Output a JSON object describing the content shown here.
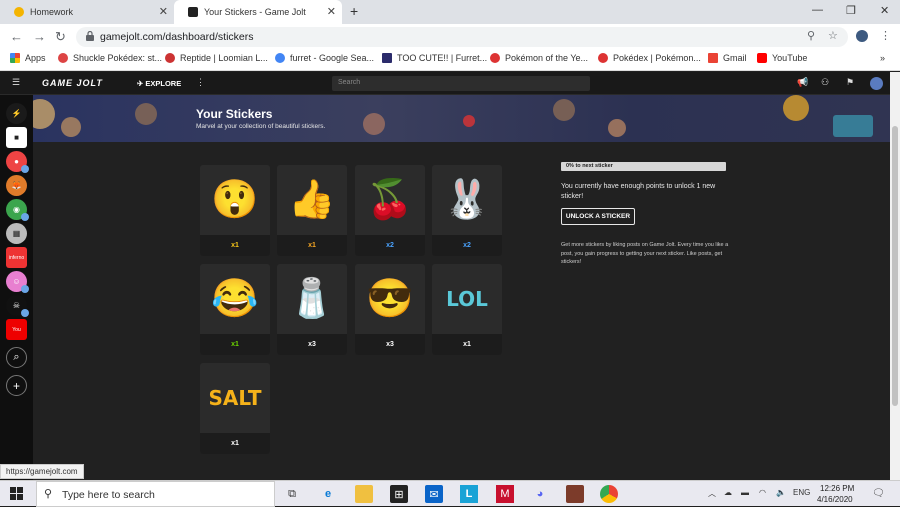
{
  "browser": {
    "tabs": [
      {
        "title": "Homework",
        "icon": "google-classroom-icon"
      },
      {
        "title": "Your Stickers - Game Jolt",
        "icon": "gamejolt-icon"
      }
    ],
    "url": "gamejolt.com/dashboard/stickers",
    "bookmarks": [
      {
        "label": "Apps",
        "color": "#e44"
      },
      {
        "label": "Shuckle Pokédex: st...",
        "color": "#d44"
      },
      {
        "label": "Reptide | Loomian L...",
        "color": "#c33"
      },
      {
        "label": "furret - Google Sea...",
        "color": "#4285f4"
      },
      {
        "label": "TOO CUTE!! | Furret...",
        "color": "#2b2b6b"
      },
      {
        "label": "Pokémon of the Ye...",
        "color": "#d33"
      },
      {
        "label": "Pokédex | Pokémon...",
        "color": "#d33"
      },
      {
        "label": "Gmail",
        "color": "#ea4335"
      },
      {
        "label": "YouTube",
        "color": "#f00"
      }
    ],
    "status_url": "https://gamejolt.com"
  },
  "gamejolt": {
    "logo": "GAME JOLT",
    "explore": "EXPLORE",
    "search_placeholder": "Search",
    "banner_title": "Your Stickers",
    "banner_subtitle": "Marvel at your collection of beautiful stickers."
  },
  "stickers": [
    {
      "emoji": "😲",
      "count": "x1",
      "count_color": "#f5c518",
      "name": "surprised-egg-sticker"
    },
    {
      "emoji": "👍",
      "count": "x1",
      "count_color": "#f5a623",
      "name": "painter-thumbs-up-sticker"
    },
    {
      "emoji": "🍒",
      "count": "x2",
      "count_color": "#4aa3ff",
      "name": "cherries-sticker"
    },
    {
      "emoji": "🐰",
      "count": "x2",
      "count_color": "#4aa3ff",
      "name": "confused-bunny-sticker"
    },
    {
      "emoji": "😂",
      "count": "x1",
      "count_color": "#6cd400",
      "name": "laughing-sticker"
    },
    {
      "emoji": "🧂",
      "count": "x3",
      "count_color": "#ffffff",
      "name": "salt-shaker-sticker"
    },
    {
      "emoji": "😎",
      "count": "x3",
      "count_color": "#ffffff",
      "name": "cool-sunglasses-sticker"
    },
    {
      "emoji": "LOL",
      "count": "x1",
      "count_color": "#ffffff",
      "name": "lol-sticker"
    },
    {
      "emoji": "SALT",
      "count": "x1",
      "count_color": "#ffffff",
      "name": "salt-guy-sticker"
    }
  ],
  "progress": {
    "label": "0% to next sticker",
    "value_percent": 0
  },
  "unlock": {
    "message": "You currently have enough points to unlock 1 new sticker!",
    "button": "UNLOCK A STICKER",
    "info": "Get more stickers by liking posts on Game Jolt. Every time you like a post, you gain progress to getting your next sticker. Like posts, get stickers!"
  },
  "taskbar": {
    "search_placeholder": "Type here to search",
    "language": "ENG",
    "time": "12:26 PM",
    "date": "4/16/2020"
  }
}
